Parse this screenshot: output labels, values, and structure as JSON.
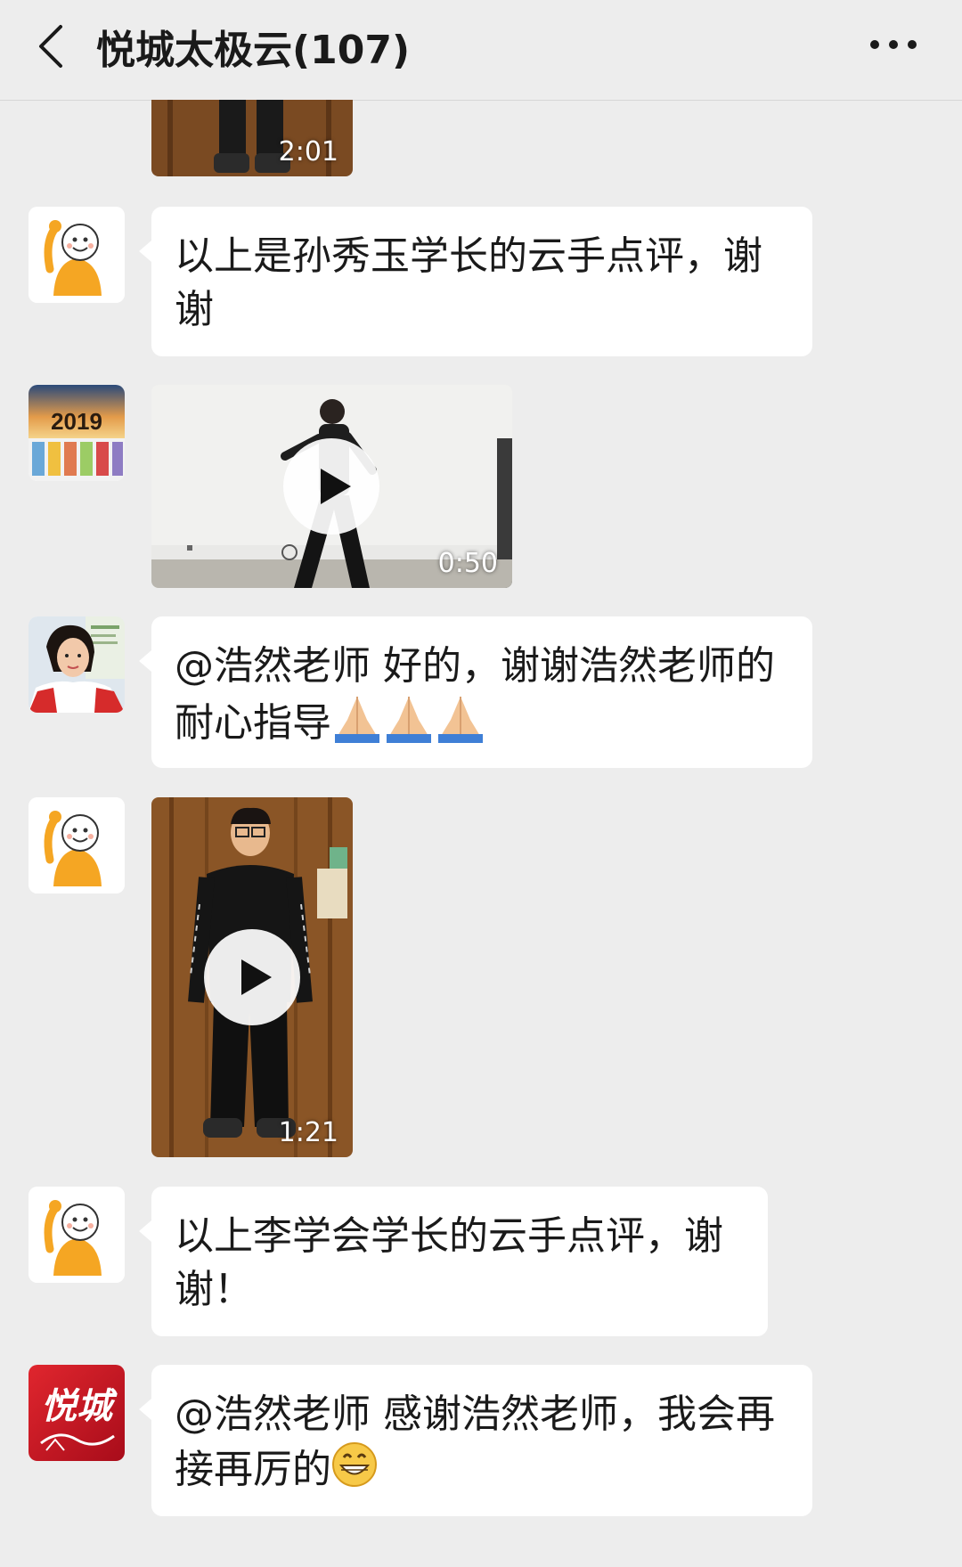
{
  "header": {
    "title": "悦城太极云(107)",
    "back_icon": "chevron-left-icon",
    "more_icon": "more-dots-icon"
  },
  "messages": [
    {
      "type": "video",
      "duration": "2:01",
      "sender_avatar": "video-thumbnail-partial"
    },
    {
      "type": "text",
      "sender_avatar": "cartoon-monk-avatar",
      "text": "以上是孙秀玉学长的云手点评，谢谢"
    },
    {
      "type": "video",
      "sender_avatar": "poster-2019-avatar",
      "avatar_text": "2019",
      "duration": "0:50"
    },
    {
      "type": "text",
      "sender_avatar": "woman-photo-avatar",
      "text": "@浩然老师  好的，谢谢浩然老师的耐心指导",
      "emoji": "folded-hands-icon"
    },
    {
      "type": "video",
      "sender_avatar": "cartoon-monk-avatar",
      "duration": "1:21"
    },
    {
      "type": "text",
      "sender_avatar": "cartoon-monk-avatar",
      "text": "以上李学会学长的云手点评，谢谢！"
    },
    {
      "type": "text",
      "sender_avatar": "yuecheng-logo-avatar",
      "avatar_text": "悦城",
      "text": "@浩然老师  感谢浩然老师，我会再接再厉的",
      "emoji": "grinning-face-icon"
    }
  ],
  "colors": {
    "background": "#ededed",
    "bubble": "#ffffff",
    "monk": "#f5a623",
    "logo_red": "#c8102e"
  }
}
